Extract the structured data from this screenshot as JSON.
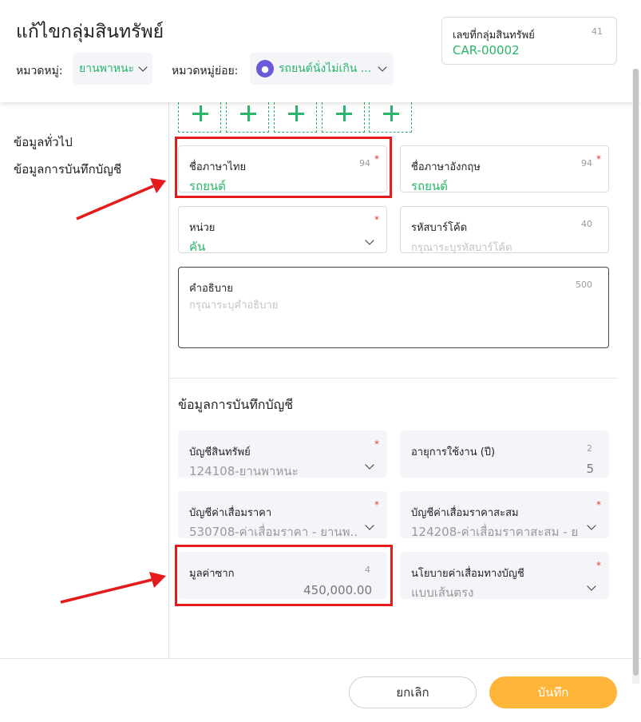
{
  "header": {
    "title": "แก้ไขกลุ่มสินทรัพย์",
    "category_label": "หมวดหมู่:",
    "category_value": "ยานพาหนะ",
    "subcategory_label": "หมวดหมู่ย่อย:",
    "subcategory_value": "รถยนต์นั่งไม่เกิน ...",
    "group_code_label": "เลขที่กลุ่มสินทรัพย์",
    "group_code_count": "41",
    "group_code_value": "CAR-00002"
  },
  "sidebar": {
    "items": [
      {
        "label": "ข้อมูลทั่วไป"
      },
      {
        "label": "ข้อมูลการบันทึกบัญชี"
      }
    ]
  },
  "general": {
    "thai_name": {
      "label": "ชื่อภาษาไทย",
      "count": "94",
      "value": "รถยนต์"
    },
    "english_name": {
      "label": "ชื่อภาษาอังกฤษ",
      "count": "94",
      "value": "รถยนต์"
    },
    "unit": {
      "label": "หน่วย",
      "value": "คัน"
    },
    "barcode": {
      "label": "รหัสบาร์โค้ด",
      "count": "40",
      "placeholder": "กรุณาระบุรหัสบาร์โค้ด"
    },
    "description": {
      "label": "คำอธิบาย",
      "count": "500",
      "placeholder": "กรุณาระบุคำอธิบาย"
    }
  },
  "accounting": {
    "title": "ข้อมูลการบันทึกบัญชี",
    "asset_account": {
      "label": "บัญชีสินทรัพย์",
      "value": "124108-ยานพาหนะ"
    },
    "useful_life": {
      "label": "อายุการใช้งาน (ปี)",
      "count": "2",
      "value": "5"
    },
    "depreciation_account": {
      "label": "บัญชีค่าเสื่อมราคา",
      "value": "530708-ค่าเสื่อมราคา - ยานพ..."
    },
    "accum_depreciation_account": {
      "label": "บัญชีค่าเสื่อมราคาสะสม",
      "value": "124208-ค่าเสื่อมราคาสะสม - ย..."
    },
    "salvage_value": {
      "label": "มูลค่าซาก",
      "count": "4",
      "value": "450,000.00"
    },
    "depreciation_policy": {
      "label": "นโยบายค่าเสื่อมทางบัญชี",
      "value": "แบบเส้นตรง"
    }
  },
  "footer": {
    "cancel_label": "ยกเลิก",
    "save_label": "บันทึก"
  },
  "required_mark": "*",
  "colors": {
    "accent_green": "#29b56a",
    "save_orange": "#ffb43a",
    "highlight_red": "#e51b1b",
    "required_red": "#e53935"
  }
}
